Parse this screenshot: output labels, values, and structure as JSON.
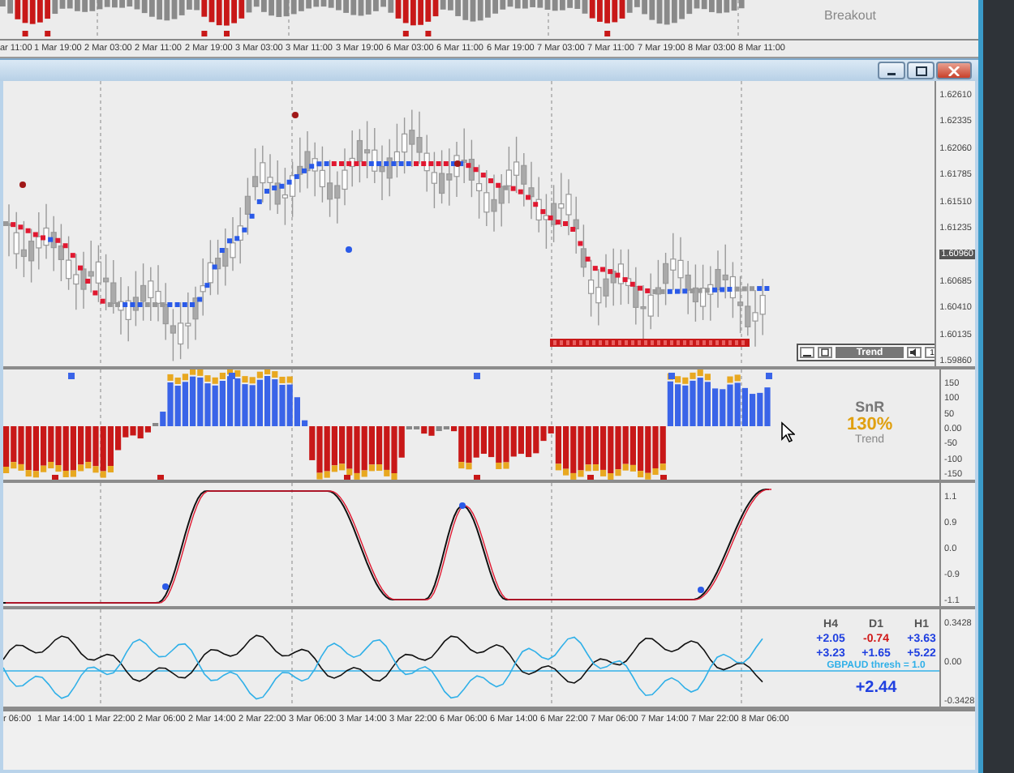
{
  "background_window": {
    "label": "Breakout",
    "time_axis": [
      "ar 11:00",
      "1 Mar 19:00",
      "2 Mar 03:00",
      "2 Mar 11:00",
      "2 Mar 19:00",
      "3 Mar 03:00",
      "3 Mar 11:00",
      "3 Mar 19:00",
      "6 Mar 03:00",
      "6 Mar 11:00",
      "6 Mar 19:00",
      "7 Mar 03:00",
      "7 Mar 11:00",
      "7 Mar 19:00",
      "8 Mar 03:00",
      "8 Mar 11:00"
    ]
  },
  "window": {
    "controls": [
      {
        "kind": "minimize"
      },
      {
        "kind": "maximize"
      },
      {
        "kind": "close"
      }
    ]
  },
  "price_panel": {
    "price_axis": [
      {
        "label": "1.62610",
        "current": false
      },
      {
        "label": "1.62335",
        "current": false
      },
      {
        "label": "1.62060",
        "current": false
      },
      {
        "label": "1.61785",
        "current": false
      },
      {
        "label": "1.61510",
        "current": false
      },
      {
        "label": "1.61235",
        "current": false
      },
      {
        "label": "1.60960",
        "current": true
      },
      {
        "label": "1.60685",
        "current": false
      },
      {
        "label": "1.60410",
        "current": false
      },
      {
        "label": "1.60135",
        "current": false
      },
      {
        "label": "1.59860",
        "current": false
      }
    ],
    "toolbar": {
      "label": "Trend",
      "page": "1"
    }
  },
  "snr_panel": {
    "axis": [
      "150",
      "100",
      "50",
      "0.00",
      "-50",
      "-100",
      "-150"
    ],
    "title": "SnR",
    "value": "130%",
    "caption": "Trend"
  },
  "oscillator_panel": {
    "axis": [
      "1.1",
      "0.9",
      "0.0",
      "-0.9",
      "-1.1"
    ]
  },
  "strength_panel": {
    "axis": [
      "0.3428",
      "0.00",
      "-0.3428"
    ],
    "columns": [
      "H4",
      "D1",
      "H1"
    ],
    "rows": [
      [
        {
          "text": "+2.05",
          "color": "#2040e0"
        },
        {
          "text": "-0.74",
          "color": "#d01818"
        },
        {
          "text": "+3.63",
          "color": "#2040e0"
        }
      ],
      [
        {
          "text": "+3.23",
          "color": "#2040e0"
        },
        {
          "text": "+1.65",
          "color": "#2040e0"
        },
        {
          "text": "+5.22",
          "color": "#2040e0"
        }
      ]
    ],
    "threshold": "GBPAUD thresh = 1.0",
    "total": "+2.44"
  },
  "time_axis": [
    "r 06:00",
    "1 Mar 14:00",
    "1 Mar 22:00",
    "2 Mar 06:00",
    "2 Mar 14:00",
    "2 Mar 22:00",
    "3 Mar 06:00",
    "3 Mar 14:00",
    "3 Mar 22:00",
    "6 Mar 06:00",
    "6 Mar 14:00",
    "6 Mar 22:00",
    "7 Mar 06:00",
    "7 Mar 14:00",
    "7 Mar 22:00",
    "8 Mar 06:00"
  ]
}
